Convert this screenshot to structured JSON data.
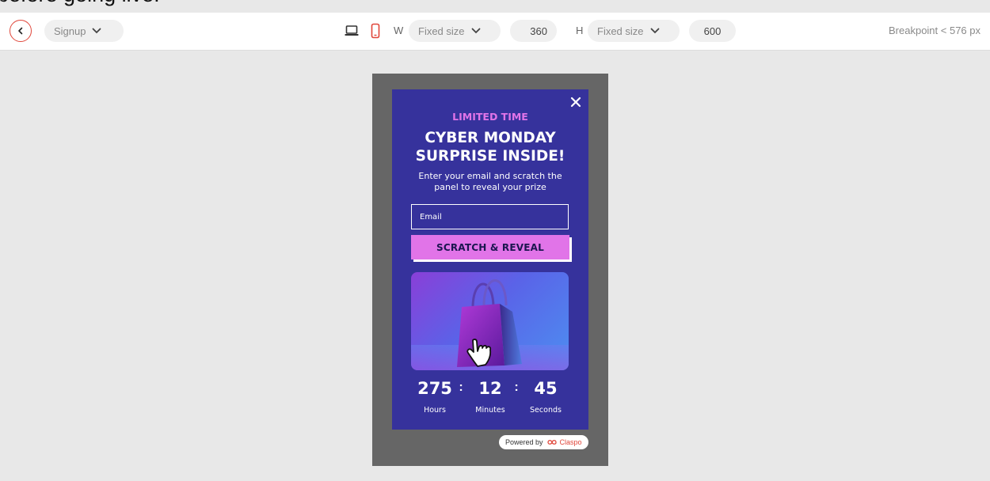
{
  "clipped_text": "before going live.",
  "toolbar": {
    "form_name": "Signup",
    "width_label": "W",
    "width_mode": "Fixed size",
    "width_value": "360",
    "height_label": "H",
    "height_mode": "Fixed size",
    "height_value": "600",
    "breakpoint": "Breakpoint < 576 px",
    "icons": [
      "back-arrow-icon",
      "chevron-down-icon",
      "laptop-icon",
      "mobile-icon"
    ],
    "active_device": "mobile"
  },
  "popup": {
    "eyebrow": "LIMITED TIME",
    "headline_line1": "CYBER MONDAY",
    "headline_line2": "SURPRISE INSIDE!",
    "subtext": "Enter your email and scratch the panel to reveal your prize",
    "email_placeholder": "Email",
    "cta_label": "SCRATCH & REVEAL",
    "timer": {
      "hours": "275",
      "minutes": "12",
      "seconds": "45",
      "separator": ":",
      "hours_label": "Hours",
      "minutes_label": "Minutes",
      "seconds_label": "Seconds"
    }
  },
  "powered": {
    "prefix": "Powered by",
    "brand": "Claspo"
  },
  "colors": {
    "popup_bg": "#36329c",
    "accent": "#e174e8",
    "stage_bg": "#666666",
    "brand_red": "#e0463a"
  }
}
